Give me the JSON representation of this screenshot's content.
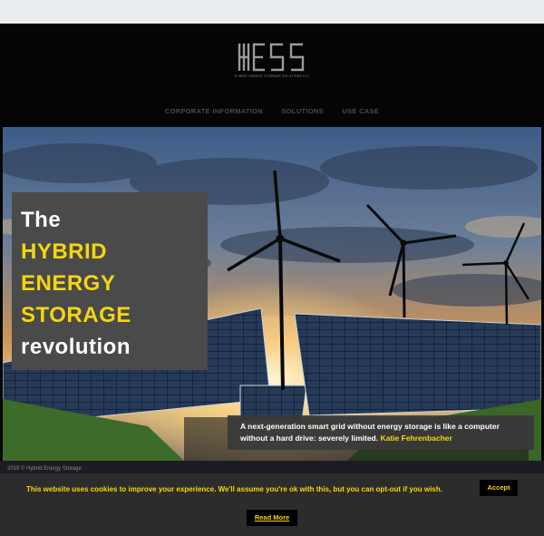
{
  "brand": {
    "logo_text": "HESS",
    "tagline": "HYBRID ENERGY STORAGE SOLUTIONS LLC"
  },
  "nav": {
    "items": [
      {
        "label": "CORPORATE INFORMATION"
      },
      {
        "label": "SOLUTIONS"
      },
      {
        "label": "USE CASE"
      }
    ]
  },
  "hero": {
    "headline": {
      "line1": "The",
      "line2": "HYBRID",
      "line3": "ENERGY",
      "line4": "STORAGE",
      "line5": "revolution"
    },
    "quote": {
      "text": "A next-generation smart grid without energy storage is like a computer without a hard drive: severely limited.",
      "author": "Katie Fehrenbacher"
    }
  },
  "footer": {
    "copyright": "2019 © Hybrid Energy Storage"
  },
  "cookie": {
    "message": "This website uses cookies to improve your experience. We'll assume you're ok with this, but you can opt-out if you wish.",
    "accept_label": "Accept",
    "read_more_label": "Read More"
  },
  "colors": {
    "accent": "#f5d60f",
    "panel": "#4a4a4a",
    "background": "#050505"
  }
}
